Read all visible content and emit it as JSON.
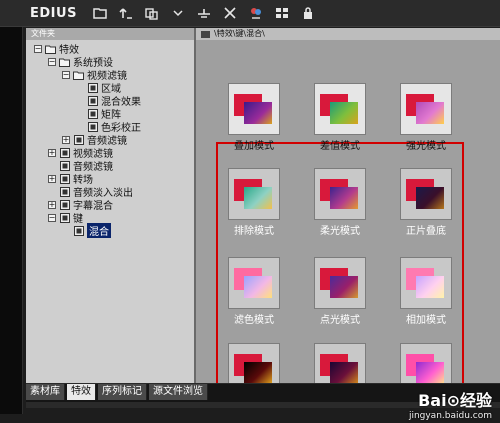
{
  "app": {
    "title": "EDIUS"
  },
  "toolbar": {
    "icons": [
      "folder-icon",
      "up-arrow-icon",
      "copy-icon",
      "align-icon",
      "delete-x-icon",
      "effect-icon",
      "grid-view-icon",
      "lock-icon"
    ]
  },
  "tree": {
    "header": "文件夹",
    "items": [
      {
        "label": "特效",
        "level": 0,
        "expander": "minus",
        "icon": "folder-icon"
      },
      {
        "label": "系统预设",
        "level": 1,
        "expander": "minus",
        "icon": "folder-icon"
      },
      {
        "label": "视频滤镜",
        "level": 2,
        "expander": "minus",
        "icon": "folder-icon"
      },
      {
        "label": "区域",
        "level": 3,
        "expander": "",
        "icon": "effect-icon"
      },
      {
        "label": "混合效果",
        "level": 3,
        "expander": "",
        "icon": "effect-icon"
      },
      {
        "label": "矩阵",
        "level": 3,
        "expander": "",
        "icon": "effect-icon"
      },
      {
        "label": "色彩校正",
        "level": 3,
        "expander": "",
        "icon": "effect-icon"
      },
      {
        "label": "音频滤镜",
        "level": 2,
        "expander": "plus",
        "icon": "effect-icon"
      },
      {
        "label": "视频滤镜",
        "level": 1,
        "expander": "plus",
        "icon": "effect-icon"
      },
      {
        "label": "音频滤镜",
        "level": 1,
        "expander": "",
        "icon": "effect-icon"
      },
      {
        "label": "转场",
        "level": 1,
        "expander": "plus",
        "icon": "effect-icon"
      },
      {
        "label": "音频淡入淡出",
        "level": 1,
        "expander": "",
        "icon": "effect-icon"
      },
      {
        "label": "字幕混合",
        "level": 1,
        "expander": "plus",
        "icon": "effect-icon"
      },
      {
        "label": "键",
        "level": 1,
        "expander": "minus",
        "icon": "effect-icon"
      },
      {
        "label": "混合",
        "level": 2,
        "expander": "",
        "icon": "effect-icon",
        "selected": true
      }
    ]
  },
  "path": {
    "text": "\\特效\\键\\混合\\"
  },
  "effects": [
    {
      "label": "叠加模式",
      "variant": "a"
    },
    {
      "label": "差值模式",
      "variant": "b"
    },
    {
      "label": "强光模式",
      "variant": "c"
    },
    {
      "label": "排除模式",
      "variant": "d",
      "highlight": true
    },
    {
      "label": "柔光模式",
      "variant": "e",
      "highlight": true
    },
    {
      "label": "正片叠底",
      "variant": "f",
      "highlight": true
    },
    {
      "label": "滤色模式",
      "variant": "g",
      "highlight": true
    },
    {
      "label": "点光模式",
      "variant": "h",
      "highlight": true
    },
    {
      "label": "相加模式",
      "variant": "i",
      "highlight": true
    },
    {
      "label": "",
      "variant": "j",
      "highlight": true
    },
    {
      "label": "",
      "variant": "k",
      "highlight": true
    },
    {
      "label": "",
      "variant": "l",
      "highlight": true
    }
  ],
  "tabs": [
    {
      "label": "素材库",
      "active": false
    },
    {
      "label": "特效",
      "active": true
    },
    {
      "label": "序列标记",
      "active": false
    },
    {
      "label": "源文件浏览",
      "active": false
    }
  ],
  "watermark": {
    "line1": "Bai⊙经验",
    "line2": "jingyan.baidu.com"
  }
}
